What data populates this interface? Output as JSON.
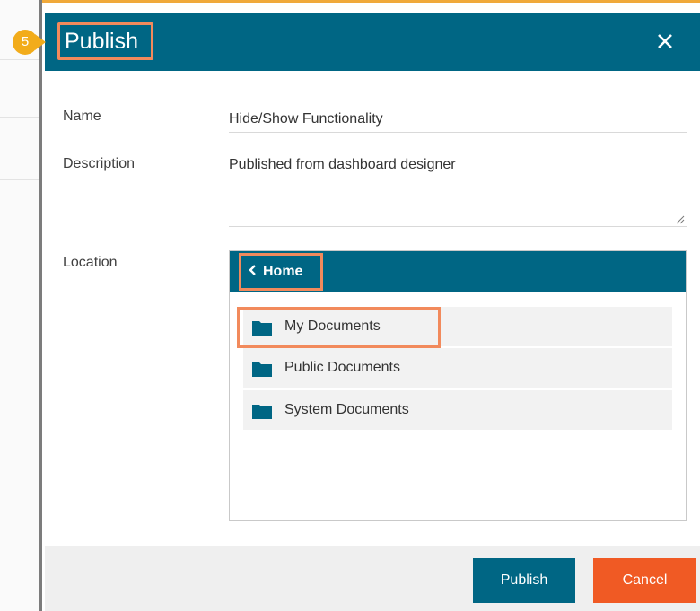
{
  "step": {
    "number": "5"
  },
  "dialog": {
    "title": "Publish",
    "close_icon": "close-icon"
  },
  "form": {
    "name_label": "Name",
    "name_value": "Hide/Show Functionality",
    "description_label": "Description",
    "description_value": "Published from dashboard designer",
    "location_label": "Location"
  },
  "location_browser": {
    "back_icon": "chevron-left-icon",
    "current": "Home",
    "folders": [
      {
        "label": "My Documents",
        "icon": "folder-icon"
      },
      {
        "label": "Public Documents",
        "icon": "folder-icon"
      },
      {
        "label": "System Documents",
        "icon": "folder-icon"
      }
    ]
  },
  "footer": {
    "publish_label": "Publish",
    "cancel_label": "Cancel"
  },
  "colors": {
    "header": "#006684",
    "highlight": "#f28a5c",
    "badge": "#f2ac1b",
    "cancel": "#f05a24"
  }
}
